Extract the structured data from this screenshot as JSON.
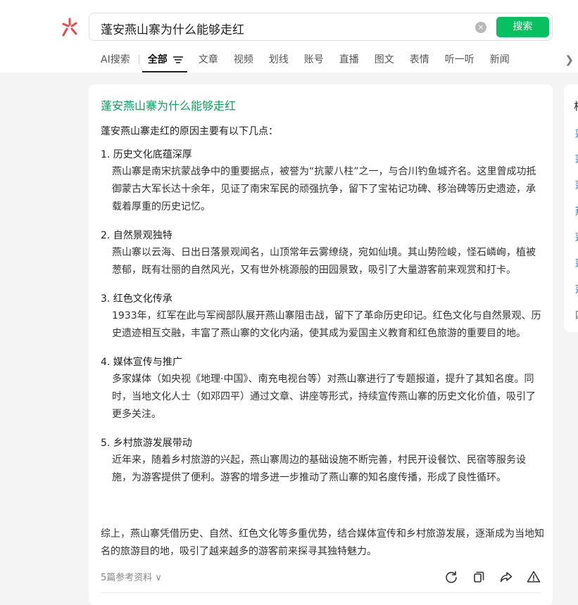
{
  "header": {
    "query": "蓬安燕山寨为什么能够走红",
    "clear_label": "×",
    "search_label": "搜索"
  },
  "tabs": [
    {
      "label": "AI搜索"
    },
    {
      "label": "全部"
    },
    {
      "label": "文章"
    },
    {
      "label": "视频"
    },
    {
      "label": "划线"
    },
    {
      "label": "账号"
    },
    {
      "label": "直播"
    },
    {
      "label": "图文"
    },
    {
      "label": "表情"
    },
    {
      "label": "听一听"
    },
    {
      "label": "新闻"
    }
  ],
  "answer": {
    "title": "蓬安燕山寨为什么能够走红",
    "intro": "蓬安燕山寨走红的原因主要有以下几点：",
    "points": [
      {
        "heading": "1. 历史文化底蕴深厚",
        "body": "燕山寨是南宋抗蒙战争中的重要据点，被誉为“抗蒙八柱”之一，与合川钓鱼城齐名。这里曾成功抵御蒙古大军长达十余年，见证了南宋军民的顽强抗争，留下了宝祐记功碑、移治碑等历史遗迹，承载着厚重的历史记忆。"
      },
      {
        "heading": "2. 自然景观独特",
        "body": "燕山寨以云海、日出日落景观闻名，山顶常年云雾缭绕，宛如仙境。其山势险峻，怪石嶙峋，植被葱郁，既有壮丽的自然风光，又有世外桃源般的田园景致，吸引了大量游客前来观赏和打卡。"
      },
      {
        "heading": "3. 红色文化传承",
        "body": "1933年，红军在此与军阀部队展开燕山寨阻击战，留下了革命历史印记。红色文化与自然景观、历史遗迹相互交融，丰富了燕山寨的文化内涵，使其成为爱国主义教育和红色旅游的重要目的地。"
      },
      {
        "heading": "4. 媒体宣传与推广",
        "body": "多家媒体（如央视《地理·中国》、南充电视台等）对燕山寨进行了专题报道，提升了其知名度。同时，当地文化人士（如邓四平）通过文章、讲座等形式，持续宣传燕山寨的历史文化价值，吸引了更多关注。"
      },
      {
        "heading": "5. 乡村旅游发展带动",
        "body": "近年来，随着乡村旅游的兴起，燕山寨周边的基础设施不断完善，村民开设餐饮、民宿等服务设施，为游客提供了便利。游客的增多进一步推动了燕山寨的知名度传播，形成了良性循环。"
      }
    ],
    "summary": "综上，燕山寨凭借历史、自然、红色文化等多重优势，结合媒体宣传和乡村旅游发展，逐渐成为当地知名的旅游目的地，吸引了越来越多的游客前来探寻其独特魅力。",
    "refs_label": "5篇参考资料 ∨"
  },
  "side": {
    "title": "相",
    "links": [
      "蓬",
      "蓬",
      "蓬",
      "燕",
      "蓬",
      "蓬",
      "蓬",
      "四"
    ]
  },
  "colors": {
    "accent": "#07c160",
    "title_green": "#07a35a",
    "link_blue": "#1e6fd9"
  }
}
